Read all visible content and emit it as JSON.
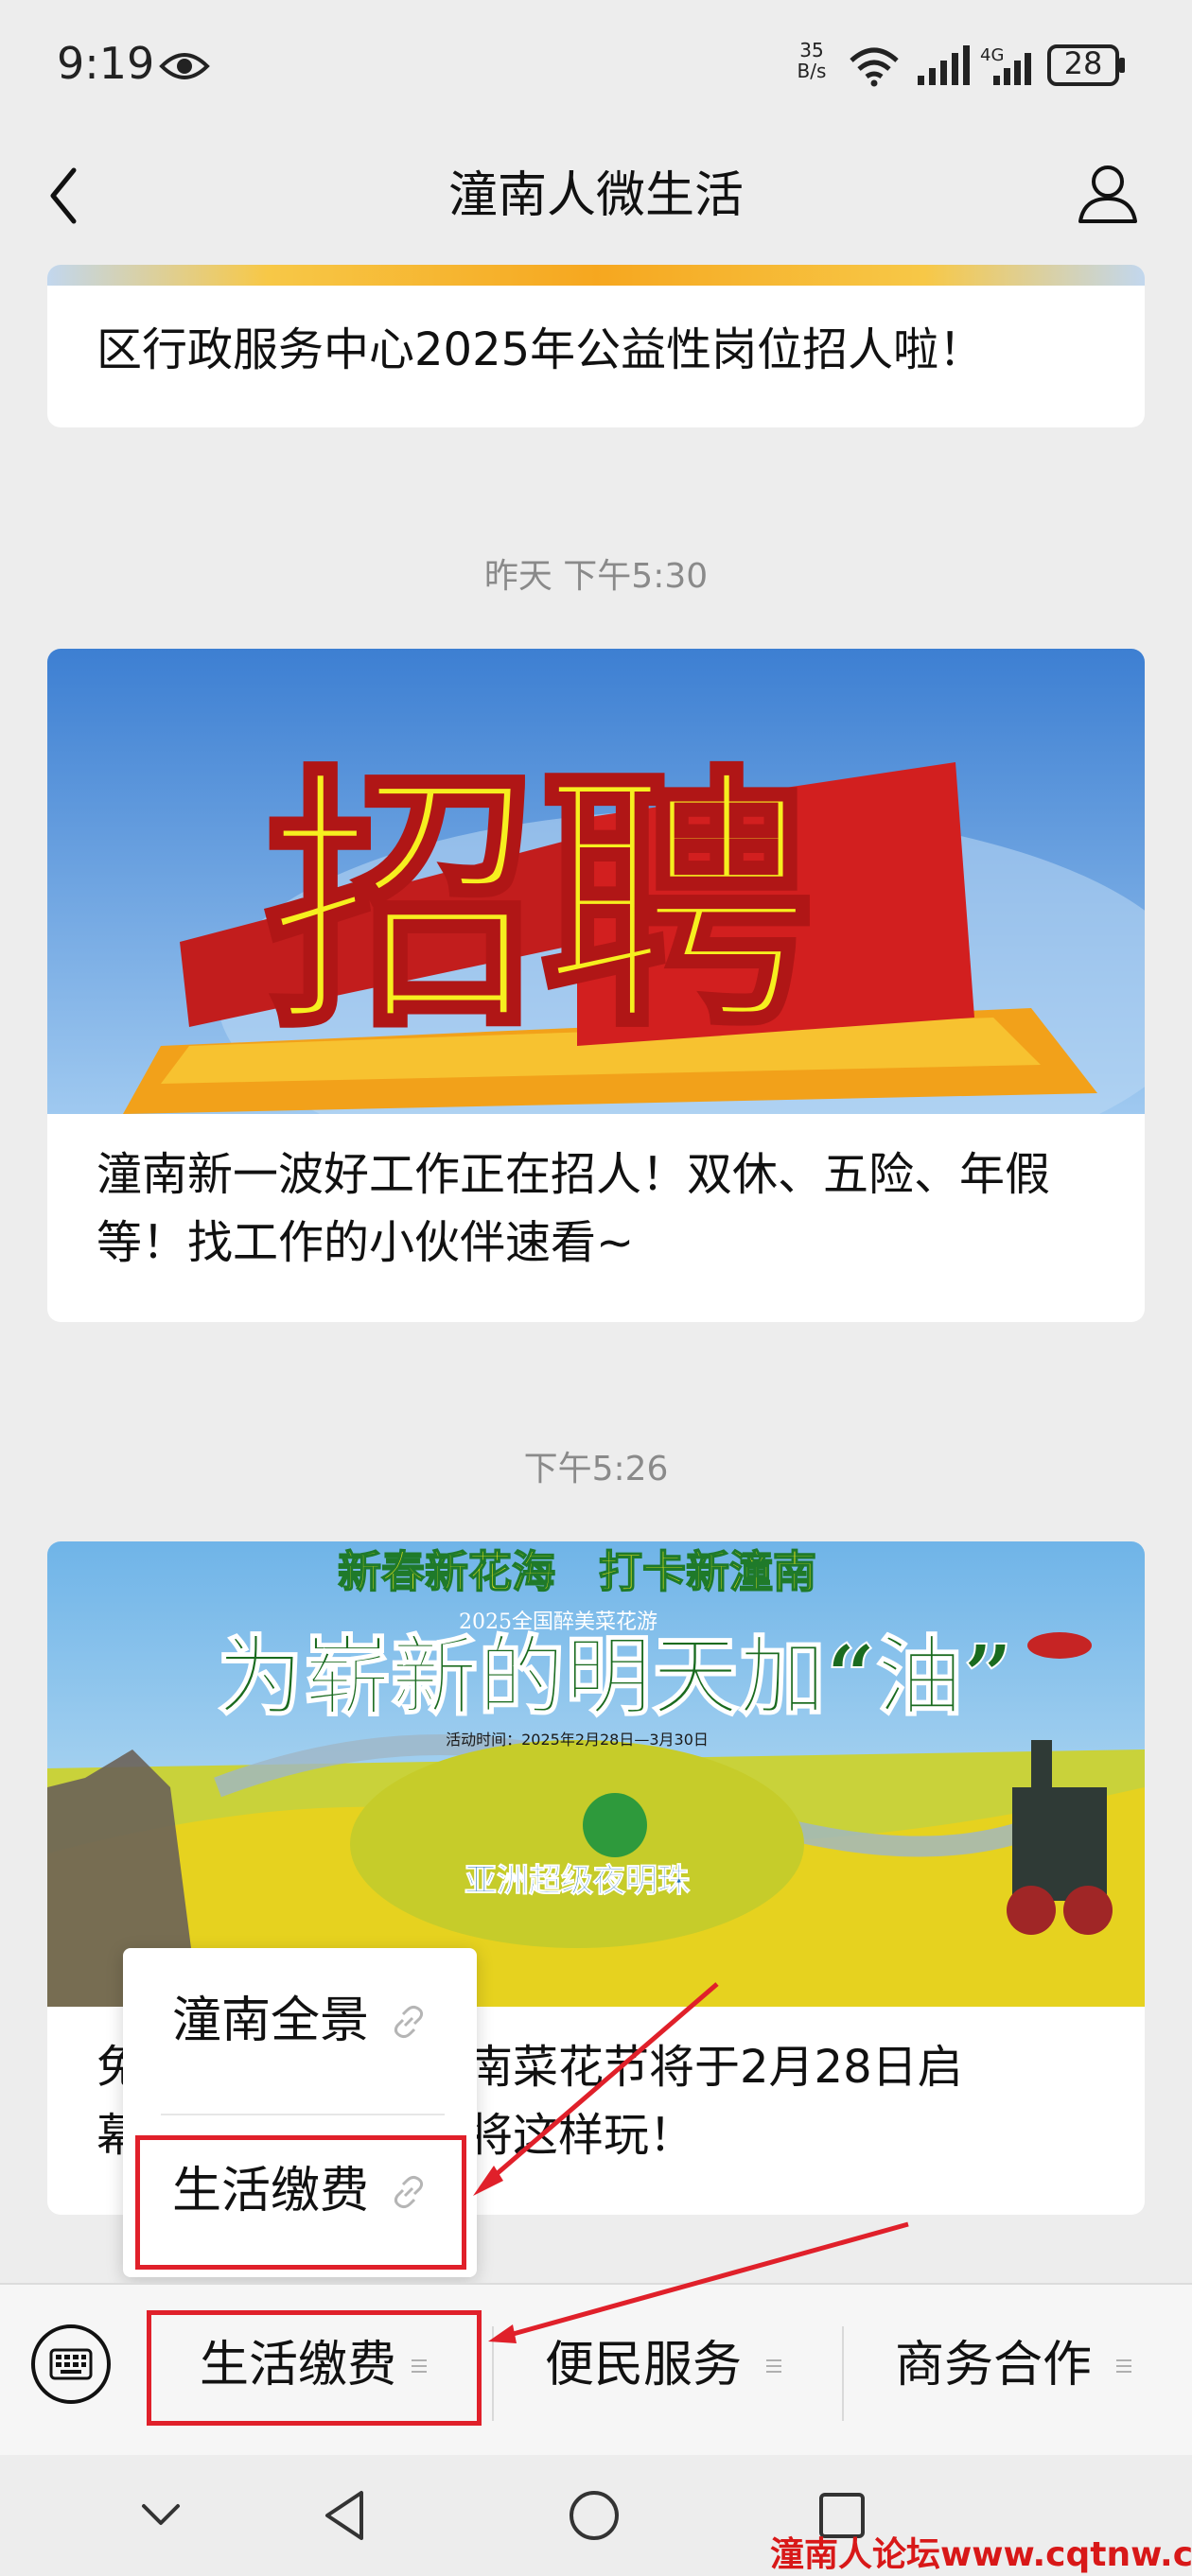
{
  "status_bar": {
    "time": "9:19",
    "net_speed_value": "35",
    "net_speed_unit": "B/s",
    "network_type": "4G",
    "battery": "28"
  },
  "header": {
    "title": "潼南人微生活",
    "back_icon": "chevron-left-icon",
    "profile_icon": "person-icon"
  },
  "feed": {
    "cards": [
      {
        "title": "区行政服务中心2025年公益性岗位招人啦！"
      },
      {
        "timestamp": "昨天 下午5:30",
        "image_text": "招聘",
        "title": "潼南新一波好工作正在招人！双休、五险、年假等！找工作的小伙伴速看~"
      },
      {
        "timestamp": "下午5:26",
        "image_headline": "新春新花海　打卡新潼南",
        "image_subline": "2025全国醉美菜花游",
        "image_slogan": "为崭新的明天加“油”",
        "image_date": "活动时间：2025年2月28日—3月30日",
        "image_caption": "亚洲超级夜明珠",
        "title_visible_left": "免\n幕",
        "title_visible_right": "南菜花节将于2月28日启\n将这样玩！"
      }
    ]
  },
  "popup_menu": {
    "items": [
      {
        "label": "潼南全景",
        "icon": "link-icon"
      },
      {
        "label": "生活缴费",
        "icon": "link-icon"
      }
    ]
  },
  "bottom_menu": {
    "keyboard_icon": "keyboard-icon",
    "items": [
      {
        "label": "生活缴费"
      },
      {
        "label": "便民服务"
      },
      {
        "label": "商务合作"
      }
    ]
  },
  "watermark": "潼南人论坛www.cqtnw.cn",
  "colors": {
    "background": "#ededed",
    "card": "#ffffff",
    "highlight_red": "#e0202a",
    "timestamp_gray": "#8a8a8a"
  }
}
